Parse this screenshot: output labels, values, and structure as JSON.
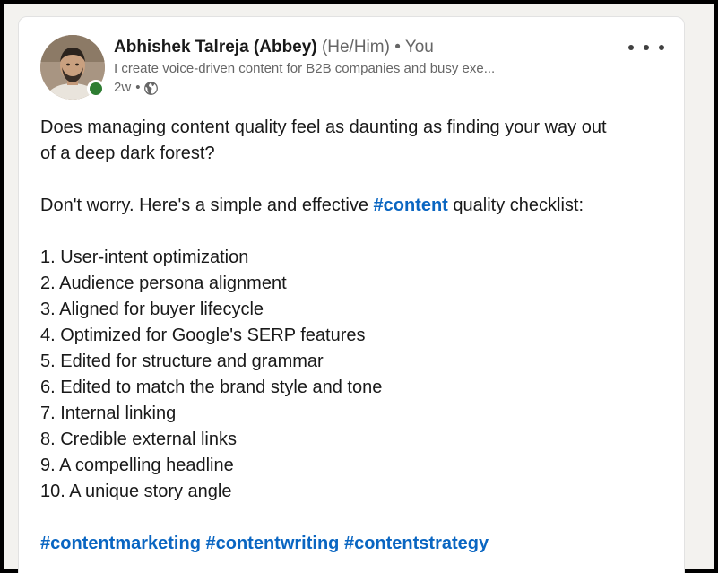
{
  "post": {
    "author": {
      "name": "Abhishek Talreja (Abbey)",
      "pronouns": "(He/Him)",
      "separator": "•",
      "relation": "You",
      "headline": "I create voice-driven content for B2B companies and busy exe...",
      "time": "2w",
      "time_separator": "•",
      "visibility_icon": "globe-icon",
      "presence_color": "#2e7d32"
    },
    "menu_icon": "more-horizontal-icon",
    "body": {
      "intro_line1": "Does managing content quality feel as daunting as finding your way out",
      "intro_line2": "of a deep dark forest?",
      "lead_before": "Don't worry. Here's a simple and effective ",
      "lead_hashtag": "#content",
      "lead_after": " quality checklist:",
      "checklist": [
        "1. User-intent optimization",
        "2. Audience persona alignment",
        "3. Aligned for buyer lifecycle",
        "4. Optimized for Google's SERP features",
        "5. Edited for structure and grammar",
        "6. Edited to match the brand style and tone",
        "7. Internal linking",
        "8. Credible external links",
        "9. A compelling headline",
        "10. A unique story angle"
      ],
      "hashtags": [
        "#contentmarketing",
        "#contentwriting",
        "#contentstrategy"
      ]
    },
    "link_color": "#0a66c2"
  }
}
